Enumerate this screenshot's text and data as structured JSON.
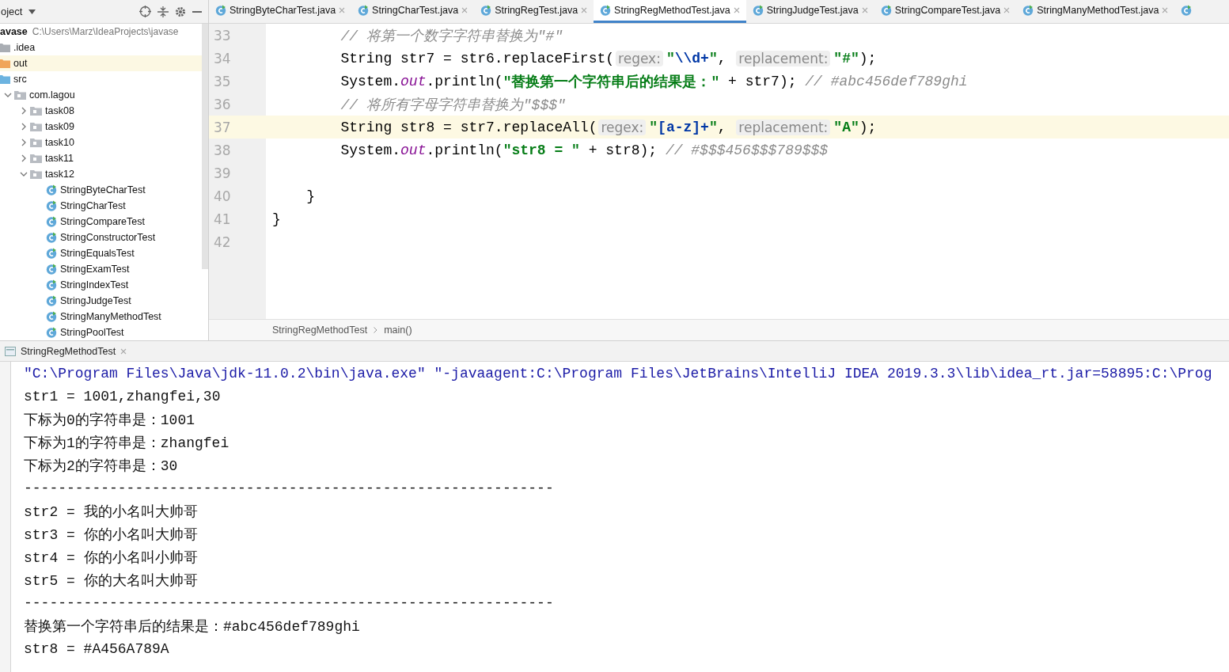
{
  "project_panel": {
    "title": "oject",
    "root": {
      "name": "avase",
      "path": "C:\\Users\\Marz\\IdeaProjects\\javase"
    },
    "tree": [
      {
        "kind": "folder",
        "name": ".idea",
        "selected": false
      },
      {
        "kind": "excluded",
        "name": "out",
        "selected": true
      },
      {
        "kind": "source",
        "name": "src",
        "selected": false,
        "children": [
          {
            "kind": "package",
            "name": "com.lagou",
            "expanded": true,
            "selected": false,
            "children": [
              {
                "kind": "package",
                "name": "task08",
                "expanded": false,
                "selected": false
              },
              {
                "kind": "package",
                "name": "task09",
                "expanded": false,
                "selected": false
              },
              {
                "kind": "package",
                "name": "task10",
                "expanded": false,
                "selected": false
              },
              {
                "kind": "package",
                "name": "task11",
                "expanded": false,
                "selected": false
              },
              {
                "kind": "package",
                "name": "task12",
                "expanded": true,
                "selected": false,
                "children": [
                  {
                    "kind": "class",
                    "name": "StringByteCharTest",
                    "selected": false
                  },
                  {
                    "kind": "class",
                    "name": "StringCharTest",
                    "selected": false
                  },
                  {
                    "kind": "class",
                    "name": "StringCompareTest",
                    "selected": false
                  },
                  {
                    "kind": "class",
                    "name": "StringConstructorTest",
                    "selected": false
                  },
                  {
                    "kind": "class",
                    "name": "StringEqualsTest",
                    "selected": false
                  },
                  {
                    "kind": "class",
                    "name": "StringExamTest",
                    "selected": false
                  },
                  {
                    "kind": "class",
                    "name": "StringIndexTest",
                    "selected": false
                  },
                  {
                    "kind": "class",
                    "name": "StringJudgeTest",
                    "selected": false
                  },
                  {
                    "kind": "class",
                    "name": "StringManyMethodTest",
                    "selected": false
                  },
                  {
                    "kind": "class",
                    "name": "StringPoolTest",
                    "selected": false
                  }
                ]
              }
            ]
          }
        ]
      }
    ]
  },
  "editor_tabs": [
    {
      "label": "StringByteCharTest.java",
      "selected": false
    },
    {
      "label": "StringCharTest.java",
      "selected": false
    },
    {
      "label": "StringRegTest.java",
      "selected": false
    },
    {
      "label": "StringRegMethodTest.java",
      "selected": true
    },
    {
      "label": "StringJudgeTest.java",
      "selected": false
    },
    {
      "label": "StringCompareTest.java",
      "selected": false
    },
    {
      "label": "StringManyMethodTest.java",
      "selected": false
    }
  ],
  "code_lines": [
    {
      "number": "33",
      "current": false,
      "tokens": [
        {
          "kind": "comment",
          "text": "        // 将第一个数字字符串替换为\"#\""
        }
      ]
    },
    {
      "number": "34",
      "current": false,
      "tokens": [
        {
          "kind": "plain",
          "text": "        String str7 = str6.replaceFirst("
        },
        {
          "kind": "hint",
          "text": "regex:"
        },
        {
          "kind": "string",
          "text": "\""
        },
        {
          "kind": "escape",
          "text": "\\\\d+"
        },
        {
          "kind": "string",
          "text": "\""
        },
        {
          "kind": "plain",
          "text": ", "
        },
        {
          "kind": "hint",
          "text": "replacement:"
        },
        {
          "kind": "string",
          "text": "\"#\""
        },
        {
          "kind": "plain",
          "text": ");"
        }
      ]
    },
    {
      "number": "35",
      "current": false,
      "tokens": [
        {
          "kind": "plain",
          "text": "        System."
        },
        {
          "kind": "field",
          "text": "out"
        },
        {
          "kind": "plain",
          "text": ".println("
        },
        {
          "kind": "string",
          "text": "\"替换第一个字符串后的结果是：\""
        },
        {
          "kind": "plain",
          "text": " + str7); "
        },
        {
          "kind": "comment",
          "text": "// #abc456def789ghi"
        }
      ]
    },
    {
      "number": "36",
      "current": false,
      "tokens": [
        {
          "kind": "comment",
          "text": "        // 将所有字母字符串替换为\"$$$\""
        }
      ]
    },
    {
      "number": "37",
      "current": true,
      "tokens": [
        {
          "kind": "plain",
          "text": "        String str8 = str7.replaceAll("
        },
        {
          "kind": "hint",
          "text": "regex:"
        },
        {
          "kind": "string",
          "text": "\""
        },
        {
          "kind": "escape",
          "text": "[a-z]+"
        },
        {
          "kind": "string",
          "text": "\""
        },
        {
          "kind": "plain",
          "text": ", "
        },
        {
          "kind": "hint",
          "text": "replacement:"
        },
        {
          "kind": "string",
          "text": "\"A\""
        },
        {
          "kind": "plain",
          "text": ");"
        }
      ]
    },
    {
      "number": "38",
      "current": false,
      "tokens": [
        {
          "kind": "plain",
          "text": "        System."
        },
        {
          "kind": "field",
          "text": "out"
        },
        {
          "kind": "plain",
          "text": ".println("
        },
        {
          "kind": "string",
          "text": "\"str8 = \""
        },
        {
          "kind": "plain",
          "text": " + str8); "
        },
        {
          "kind": "comment",
          "text": "// #$$$456$$$789$$$"
        }
      ]
    },
    {
      "number": "39",
      "current": false
    },
    {
      "number": "40",
      "current": false,
      "tokens": [
        {
          "kind": "plain",
          "text": "    }"
        }
      ]
    },
    {
      "number": "41",
      "current": false,
      "tokens": [
        {
          "kind": "plain",
          "text": "}"
        }
      ]
    },
    {
      "number": "42",
      "current": false
    }
  ],
  "breadcrumb": [
    "StringRegMethodTest",
    "main()"
  ],
  "run_panel": {
    "tab": "StringRegMethodTest",
    "lines": [
      {
        "kind": "command",
        "text": "\"C:\\Program Files\\Java\\jdk-11.0.2\\bin\\java.exe\" \"-javaagent:C:\\Program Files\\JetBrains\\IntelliJ IDEA 2019.3.3\\lib\\idea_rt.jar=58895:C:\\Prog"
      },
      {
        "kind": "output",
        "text": "str1 = 1001,zhangfei,30"
      },
      {
        "kind": "output",
        "text": "下标为0的字符串是：1001"
      },
      {
        "kind": "output",
        "text": "下标为1的字符串是：zhangfei"
      },
      {
        "kind": "output",
        "text": "下标为2的字符串是：30"
      },
      {
        "kind": "output",
        "text": "--------------------------------------------------------------"
      },
      {
        "kind": "output",
        "text": "str2 = 我的小名叫大帅哥"
      },
      {
        "kind": "output",
        "text": "str3 = 你的小名叫大帅哥"
      },
      {
        "kind": "output",
        "text": "str4 = 你的小名叫小帅哥"
      },
      {
        "kind": "output",
        "text": "str5 = 你的大名叫大帅哥"
      },
      {
        "kind": "output",
        "text": "--------------------------------------------------------------"
      },
      {
        "kind": "output",
        "text": "替换第一个字符串后的结果是：#abc456def789ghi"
      },
      {
        "kind": "output",
        "text": "str8 = #A456A789A"
      }
    ]
  }
}
